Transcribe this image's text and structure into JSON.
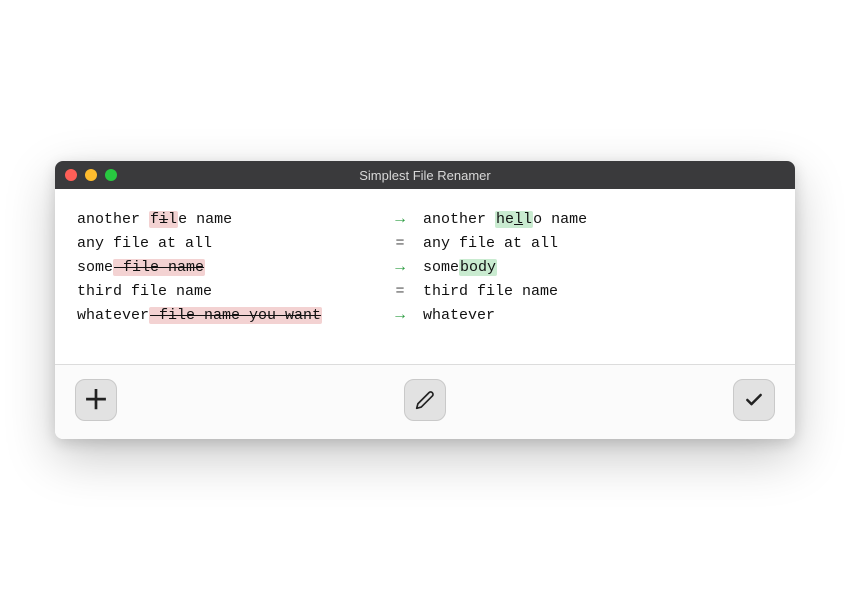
{
  "window": {
    "title": "Simplest File Renamer"
  },
  "rows": [
    {
      "before_pre": "another ",
      "before_del": "fil",
      "before_del_parts": [
        {
          "t": "f",
          "strike": false
        },
        {
          "t": "i",
          "strike": true
        },
        {
          "t": "l",
          "strike": false
        }
      ],
      "before_post": "e name",
      "changed": true,
      "after_pre": "another ",
      "after_add": "hell",
      "after_add_parts": [
        {
          "t": "he",
          "u": false
        },
        {
          "t": "l",
          "u": true
        },
        {
          "t": "l",
          "u": false
        }
      ],
      "after_post": "o name"
    },
    {
      "before_plain": "any file at all",
      "changed": false,
      "after_plain": "any file at all"
    },
    {
      "before_pre": "some",
      "before_del_strike": " file name",
      "changed": true,
      "after_pre": "some",
      "after_add": "body",
      "after_post": ""
    },
    {
      "before_plain": "third file name",
      "changed": false,
      "after_plain": "third file name"
    },
    {
      "before_pre": "whatever",
      "before_del_strike": " file name you want",
      "changed": true,
      "after_pre": "whatever",
      "after_add": "",
      "after_post": ""
    }
  ],
  "sep": {
    "changed": "→",
    "unchanged": "="
  },
  "buttons": {
    "add": "add",
    "edit": "edit",
    "confirm": "confirm"
  },
  "colors": {
    "titlebar": "#3a3a3c",
    "del_bg": "#f3d2d2",
    "add_bg": "#c9ebd0",
    "arrow": "#2f9e44"
  }
}
